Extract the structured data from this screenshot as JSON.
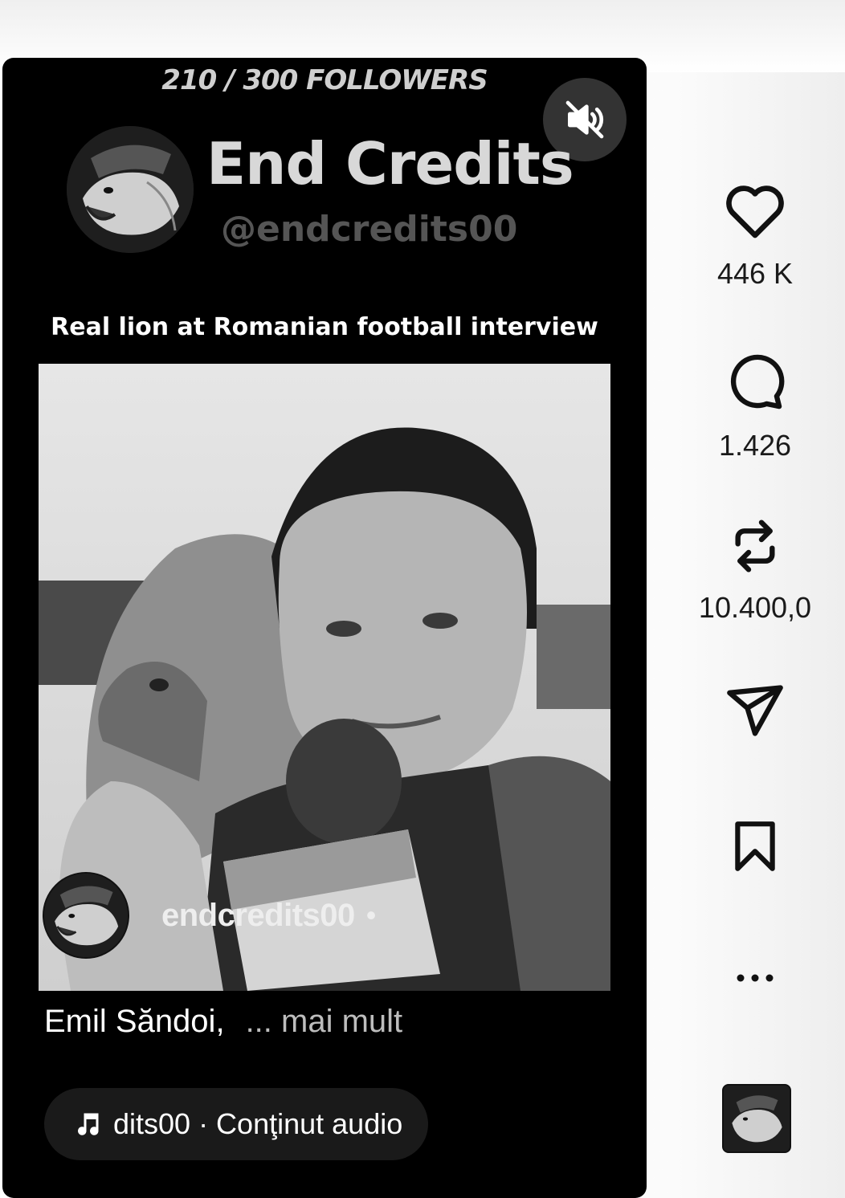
{
  "reel": {
    "followers_banner": "210 / 300 FOLLOWERS",
    "channel_name": "End Credits",
    "handle": "@endcredits00",
    "video_title": "Real lion at Romanian football interview",
    "overlay_username": "endcredits00",
    "overlay_separator": "•",
    "caption": "Emil Săndoi,",
    "caption_more": "... mai mult",
    "audio_text": "dits00 · Conţinut audio"
  },
  "actions": {
    "likes": "446 K",
    "comments": "1.426",
    "reposts": "10.400,0"
  },
  "icons": {
    "mute": "speaker-muted-icon",
    "like": "heart-icon",
    "comment": "comment-bubble-icon",
    "repost": "repost-icon",
    "share": "paper-plane-icon",
    "save": "bookmark-icon",
    "more": "more-dots-icon",
    "audio": "music-note-icon"
  },
  "colors": {
    "reel_background": "#000000",
    "text_primary": "#ffffff",
    "muted_handle": "#555555",
    "page_background": "#ffffff"
  }
}
